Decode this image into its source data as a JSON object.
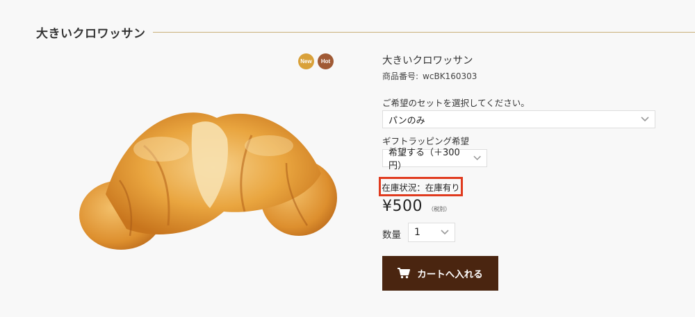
{
  "page": {
    "title": "大きいクロワッサン"
  },
  "badges": [
    {
      "label": "New",
      "color": "#d9a13a"
    },
    {
      "label": "Hot",
      "color": "#a05a35"
    }
  ],
  "product": {
    "name": "大きいクロワッサン",
    "code_label": "商品番号:",
    "code_value": "wcBK160303",
    "image_icon": "croissant-image"
  },
  "set_option": {
    "label": "ご希望のセットを選択してください。",
    "selected": "パンのみ"
  },
  "gift_option": {
    "label": "ギフトラッピング希望",
    "selected": "希望する（＋300円）"
  },
  "stock": {
    "text": "在庫状況：在庫有り",
    "highlight_color": "#e03a1e"
  },
  "price": {
    "amount": "¥500",
    "tax_note": "（税別）"
  },
  "quantity": {
    "label": "数量",
    "selected": "1"
  },
  "cart": {
    "label": "カートへ入れる",
    "icon": "cart-icon",
    "color": "#4a2510"
  },
  "colors": {
    "accent_rule": "#c9b07a",
    "background": "#f8f8f8"
  }
}
